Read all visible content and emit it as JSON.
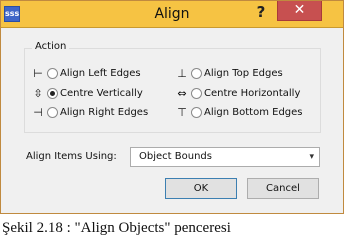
{
  "window": {
    "app_icon_text": "sss",
    "title": "Align",
    "help_label": "?",
    "close_label": "✕"
  },
  "action": {
    "group_label": "Action",
    "options": [
      {
        "glyph": "⊢",
        "label": "Align Left Edges",
        "checked": false
      },
      {
        "glyph": "⊥",
        "label": "Align Top Edges",
        "checked": false
      },
      {
        "glyph": "⇳",
        "label": "Centre Vertically",
        "checked": true
      },
      {
        "glyph": "⇔",
        "label": "Centre Horizontally",
        "checked": false
      },
      {
        "glyph": "⊣",
        "label": "Align Right Edges",
        "checked": false
      },
      {
        "glyph": "⊤",
        "label": "Align Bottom Edges",
        "checked": false
      }
    ]
  },
  "align_using": {
    "label": "Align Items Using:",
    "value": "Object Bounds",
    "arrow": "▾"
  },
  "buttons": {
    "ok": "OK",
    "cancel": "Cancel"
  },
  "caption": "Şekil 2.18 : \"Align Objects\" penceresi"
}
